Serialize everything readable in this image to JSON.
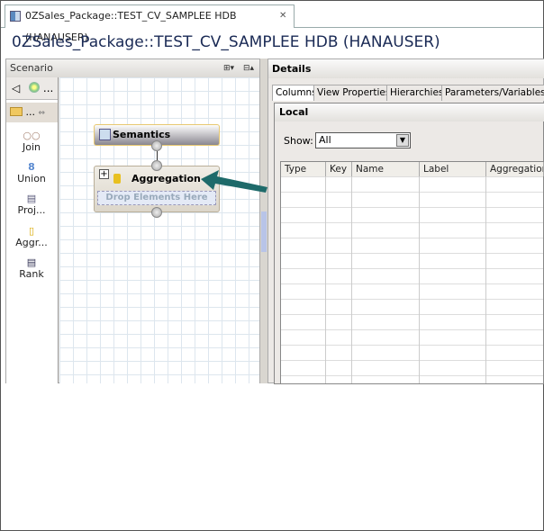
{
  "tab": {
    "label": "0ZSales_Package::TEST_CV_SAMPLEE HDB (HANAUSER)",
    "close": "✕"
  },
  "title": "0ZSales_Package::TEST_CV_SAMPLEE HDB (HANAUSER)",
  "scenario": {
    "header": "Scenario",
    "expand": "⊞▾",
    "collapse": "⊟▴",
    "toolbar1": "...",
    "toolbar2": "...",
    "palette": [
      {
        "label": "Join",
        "icon": "○○"
      },
      {
        "label": "Union",
        "icon": "8"
      },
      {
        "label": "Proj...",
        "icon": "▤"
      },
      {
        "label": "Aggr...",
        "icon": "▯"
      },
      {
        "label": "Rank",
        "icon": "▤"
      }
    ]
  },
  "nodes": {
    "semantics": "Semantics",
    "aggregation": "Aggregation",
    "drop": "Drop Elements Here",
    "plus": "+"
  },
  "details": {
    "header": "Details",
    "tabs": [
      "Columns",
      "View Properties",
      "Hierarchies",
      "Parameters/Variables"
    ],
    "local": "Local",
    "show_label": "Show:",
    "show_value": "All",
    "columns": [
      "Type",
      "Key",
      "Name",
      "Label",
      "Aggregation"
    ]
  },
  "colors": {
    "arrow": "#1e6a6a",
    "title": "#1a2a55"
  }
}
